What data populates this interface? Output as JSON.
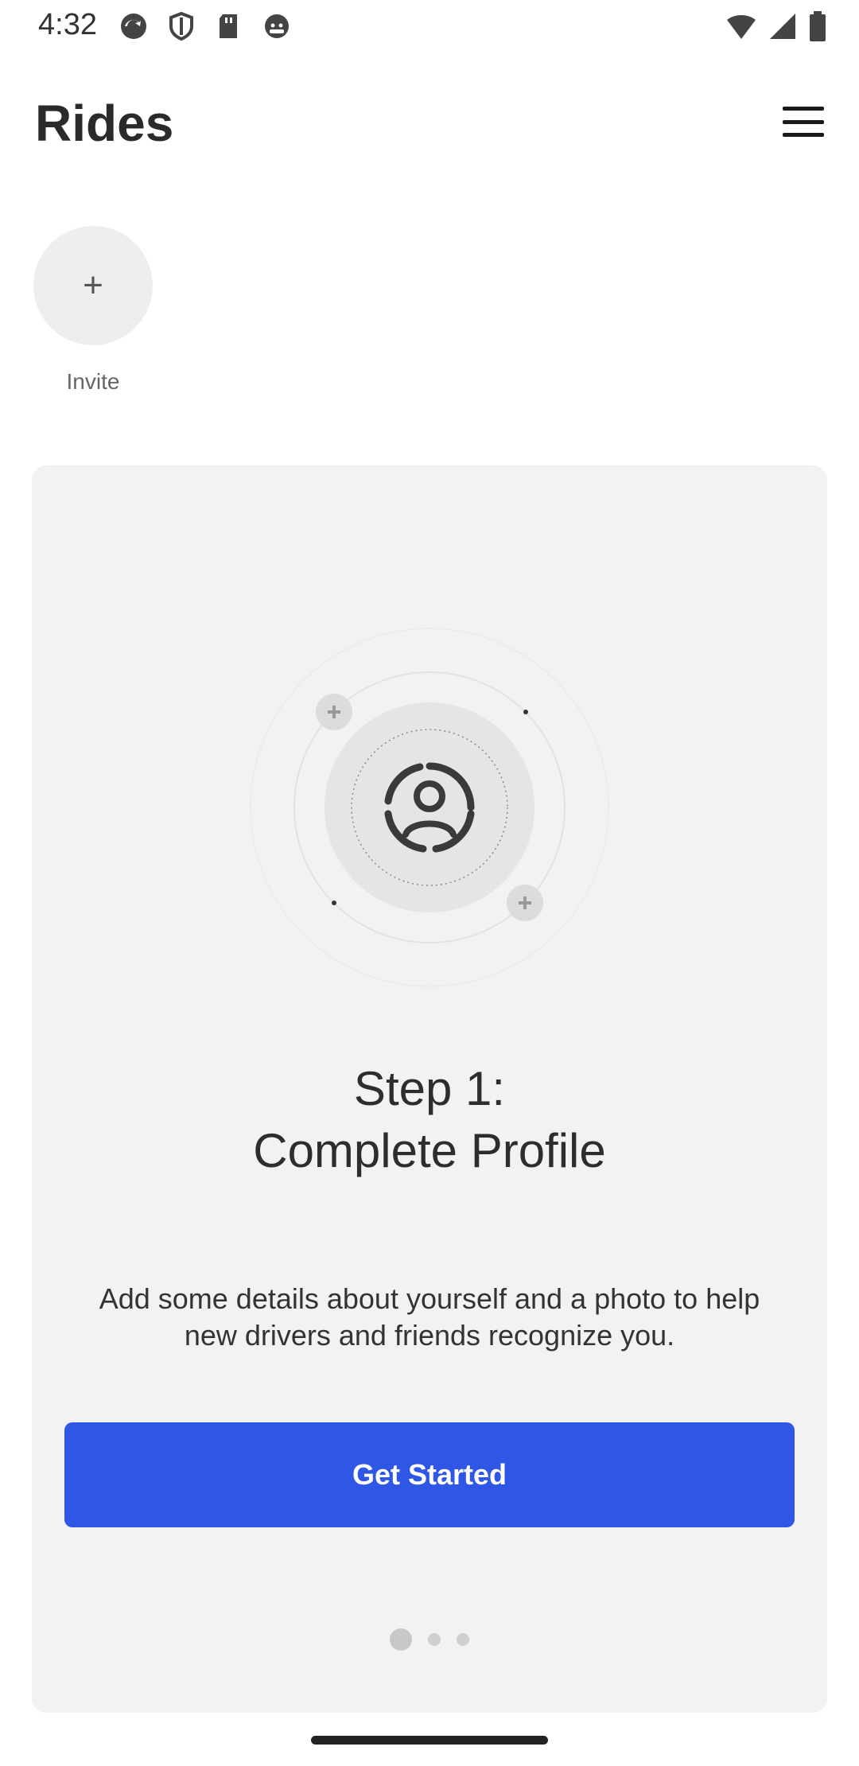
{
  "status_bar": {
    "time": "4:32",
    "left_icons": [
      "sync-icon",
      "shield-icon",
      "sd-card-icon",
      "android-icon"
    ],
    "right_icons": [
      "wifi-icon",
      "signal-icon",
      "battery-icon"
    ]
  },
  "header": {
    "title": "Rides",
    "menu_icon": "hamburger-menu-icon"
  },
  "invite": {
    "icon": "+",
    "label": "Invite"
  },
  "onboarding_card": {
    "illustration_icon": "profile-icon",
    "title_line1": "Step 1:",
    "title_line2": "Complete Profile",
    "description": "Add some details about yourself and a photo to help new drivers and friends recognize you.",
    "button_label": "Get Started",
    "pager": {
      "total": 3,
      "current": 1
    }
  },
  "colors": {
    "accent": "#3056e6",
    "card_background": "#f2f2f3",
    "invite_circle": "#eeeeee"
  }
}
